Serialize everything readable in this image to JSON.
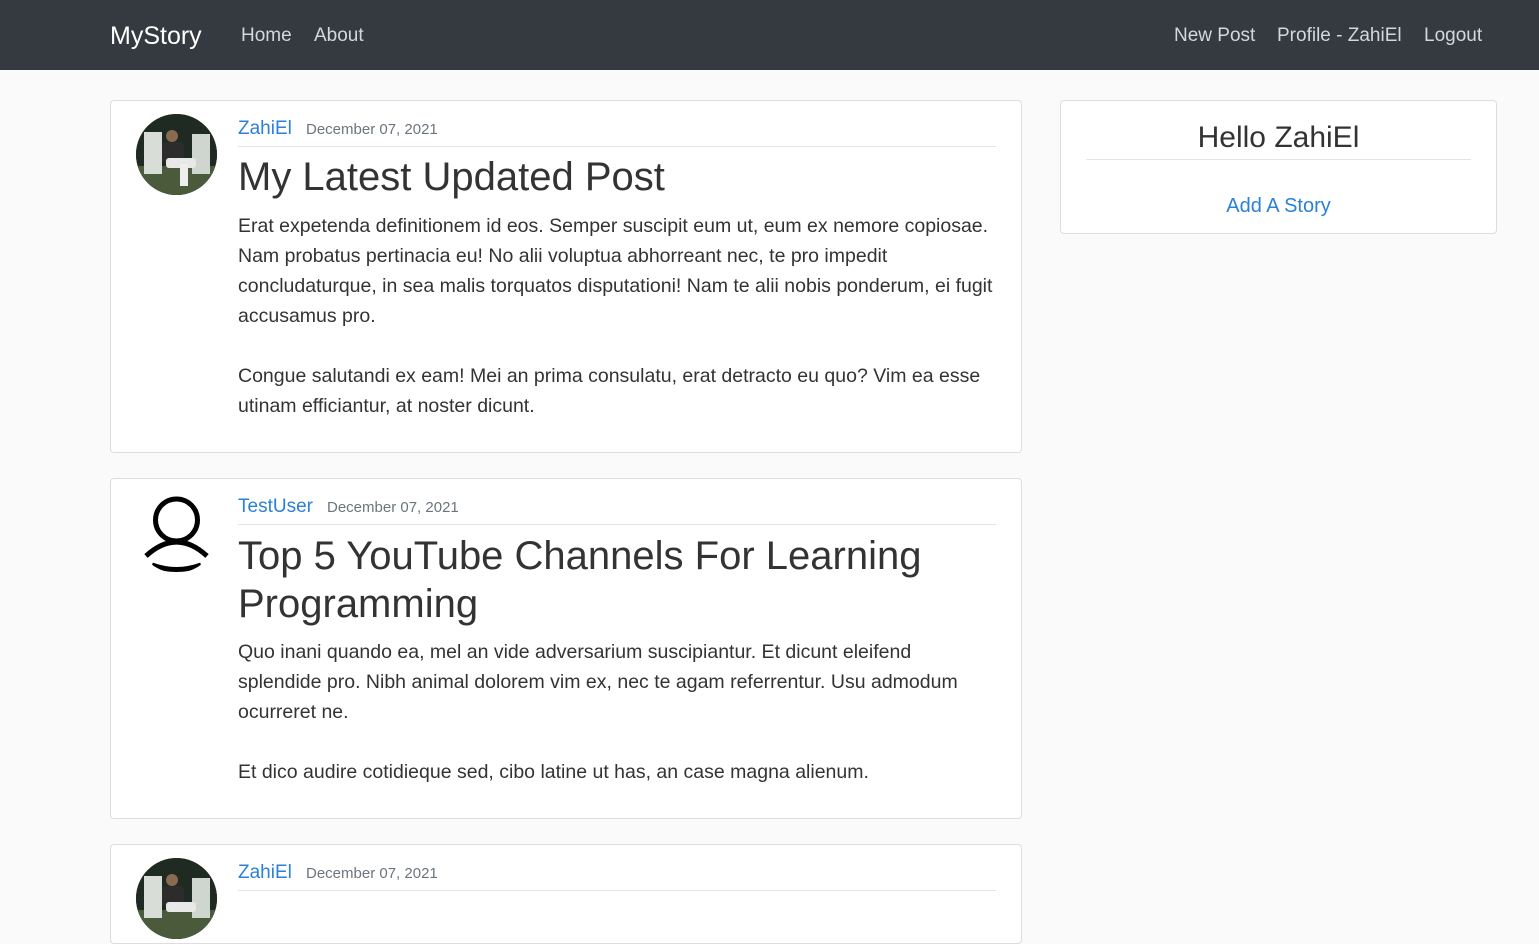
{
  "navbar": {
    "brand": "MyStory",
    "left_links": [
      "Home",
      "About"
    ],
    "right_links": [
      "New Post",
      "Profile - ZahiEl",
      "Logout"
    ]
  },
  "posts": [
    {
      "author": "ZahiEl",
      "date": "December 07, 2021",
      "avatar": "user-photo",
      "title": "My Latest Updated Post",
      "paragraphs": [
        "Erat expetenda definitionem id eos. Semper suscipit eum ut, eum ex nemore copiosae. Nam probatus pertinacia eu! No alii voluptua abhorreant nec, te pro impedit concludaturque, in sea malis torquatos disputationi! Nam te alii nobis ponderum, ei fugit accusamus pro.",
        "Congue salutandi ex eam! Mei an prima consulatu, erat detracto eu quo? Vim ea esse utinam efficiantur, at noster dicunt."
      ]
    },
    {
      "author": "TestUser",
      "date": "December 07, 2021",
      "avatar": "default-user-icon",
      "title": "Top 5 YouTube Channels For Learning Programming",
      "paragraphs": [
        "Quo inani quando ea, mel an vide adversarium suscipiantur. Et dicunt eleifend splendide pro. Nibh animal dolorem vim ex, nec te agam referrentur. Usu admodum ocurreret ne.",
        "Et dico audire cotidieque sed, cibo latine ut has, an case magna alienum."
      ]
    },
    {
      "author": "ZahiEl",
      "date": "December 07, 2021",
      "avatar": "user-photo"
    }
  ],
  "sidebar": {
    "greeting": "Hello ZahiEl",
    "add_story": "Add A Story"
  },
  "colors": {
    "navbar": "#343a40",
    "link": "#2b80d8",
    "background": "#fafafa"
  }
}
